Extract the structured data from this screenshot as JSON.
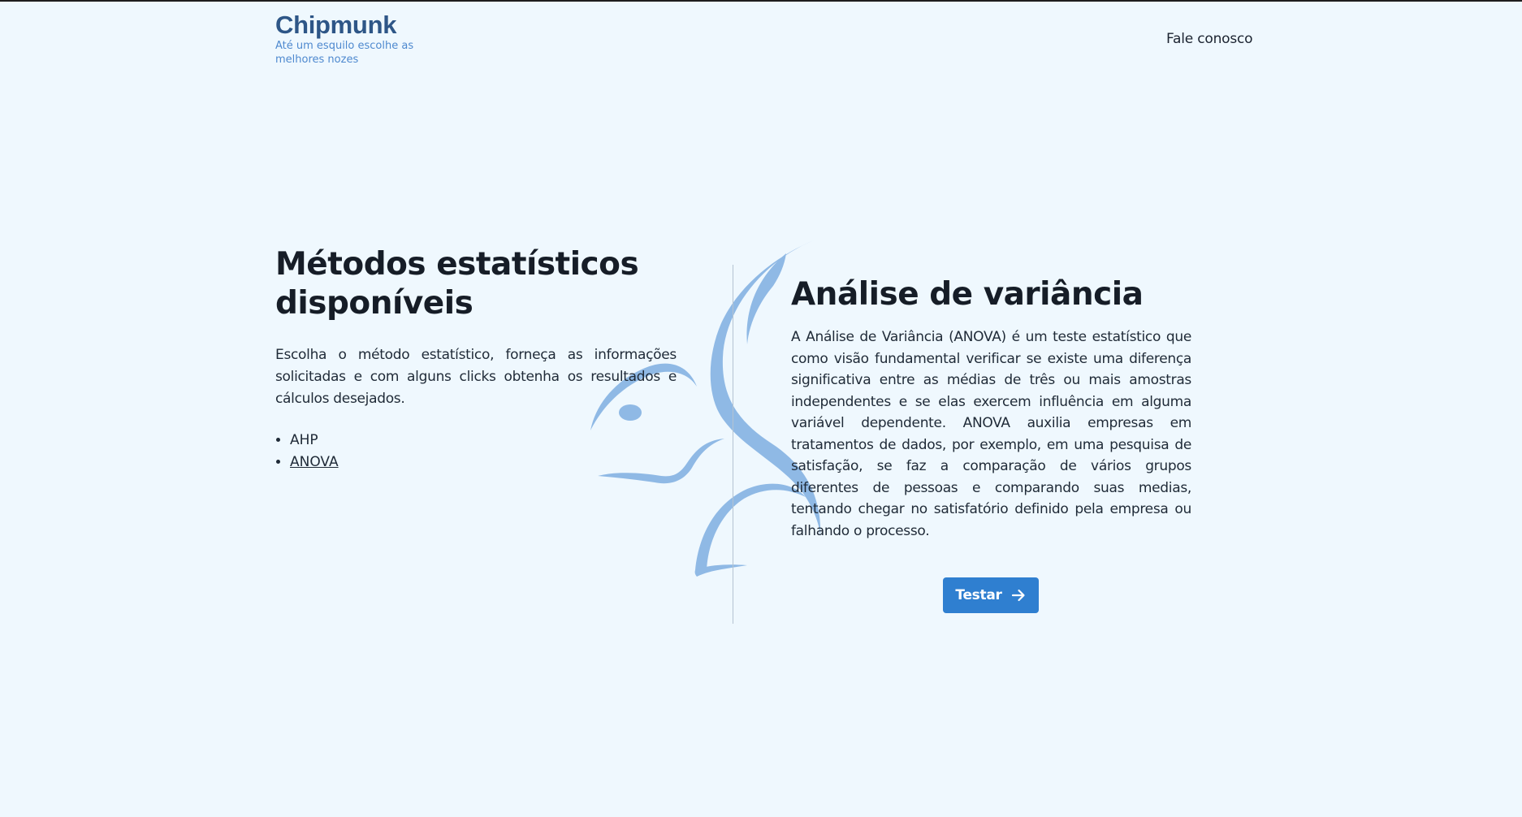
{
  "header": {
    "logo_title": "Chipmunk",
    "logo_tagline": "Até um esquilo escolhe as melhores nozes",
    "contact_label": "Fale conosco"
  },
  "methods": {
    "title": "Métodos estatísticos disponíveis",
    "description": "Escolha o método estatístico, forneça as informações solicitadas e com alguns clicks obtenha os resultados e cálculos desejados.",
    "items": [
      {
        "label": "AHP"
      },
      {
        "label": "ANOVA"
      }
    ]
  },
  "detail": {
    "title": "Análise de variância",
    "description": "A Análise de Variância (ANOVA) é um teste estatístico que como visão fundamental verificar se existe uma diferença significativa entre as médias de três ou mais amostras independentes e se elas exercem influência em alguma variável dependente. ANOVA auxilia empresas em tratamentos de dados, por exemplo, em uma pesquisa de satisfação, se faz a comparação de vários grupos diferentes de pessoas e comparando suas medias, tentando chegar no satisfatório definido pela empresa ou falhando o processo.",
    "button_label": "Testar",
    "button_icon": "arrow-right-icon"
  },
  "colors": {
    "background": "#eff8fe",
    "logo_title": "#2e5687",
    "logo_tagline": "#4e89cf",
    "squirrel_watermark": "#8fb9e5",
    "button": "#2f7fd0",
    "text": "#1f2a37"
  }
}
